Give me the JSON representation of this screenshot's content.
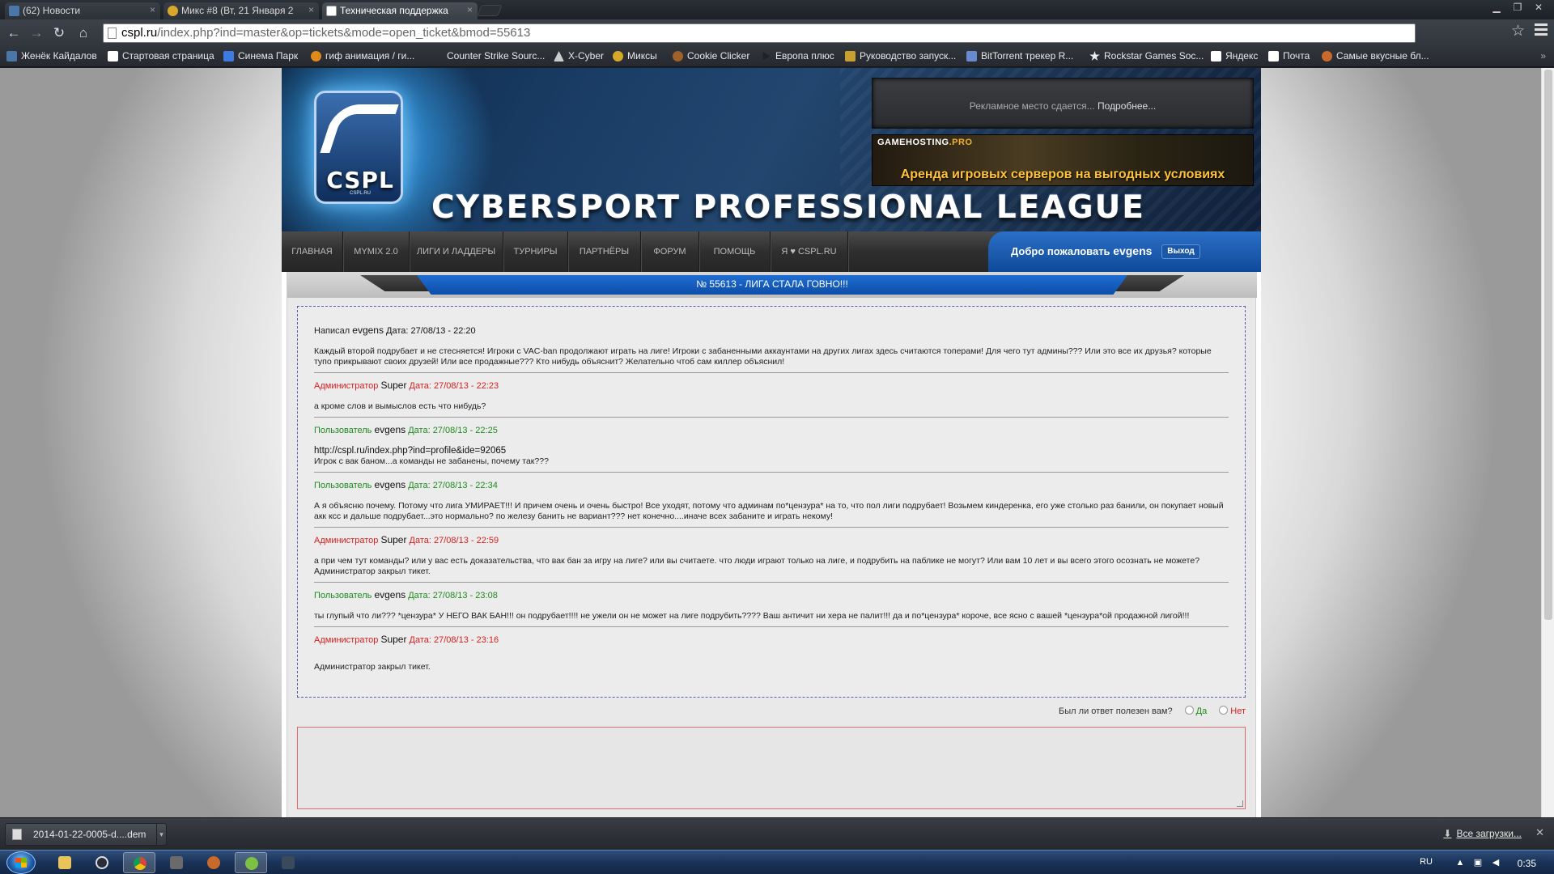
{
  "browser": {
    "tabs": [
      {
        "title": "(62) Новости",
        "favicon": "vk-icon",
        "active": false
      },
      {
        "title": "Микс #8 (Вт, 21 Января 2",
        "favicon": "mix-icon",
        "active": false
      },
      {
        "title": "Техническая поддержка",
        "favicon": "page-icon",
        "active": true
      }
    ],
    "url_host": "cspl.ru",
    "url_path": "/index.php?ind=master&op=tickets&mode=open_ticket&bmod=55613",
    "bookmarks": [
      {
        "label": "Женёк Кайдалов",
        "icon": "vk-icon",
        "color": "#4a76a8"
      },
      {
        "label": "Стартовая страница",
        "icon": "page-icon",
        "color": "#ffffff"
      },
      {
        "label": "Синема Парк",
        "icon": "cinema-icon",
        "color": "#3d7be0"
      },
      {
        "label": "гиф анимация / ги...",
        "icon": "gif-icon",
        "color": "#e08a1c"
      },
      {
        "label": "Counter Strike Sourc...",
        "icon": "",
        "color": ""
      },
      {
        "label": "X-Cyber",
        "icon": "xcyber-icon",
        "color": "#cccccc"
      },
      {
        "label": "Миксы",
        "icon": "mix-icon",
        "color": "#d8a82a"
      },
      {
        "label": "Cookie Clicker",
        "icon": "cookie-icon",
        "color": "#a0622a"
      },
      {
        "label": "Европа плюс",
        "icon": "play-icon",
        "color": "#222222"
      },
      {
        "label": "Руководство запуск...",
        "icon": "guide-icon",
        "color": "#c8a030"
      },
      {
        "label": "BitTorrent трекер R...",
        "icon": "torrent-icon",
        "color": "#6a8ad0"
      },
      {
        "label": "Rockstar Games Soc...",
        "icon": "rockstar-icon",
        "color": "#eeeeee"
      },
      {
        "label": "Яндекс",
        "icon": "page-icon",
        "color": "#ffffff"
      },
      {
        "label": "Почта",
        "icon": "page-icon",
        "color": "#ffffff"
      },
      {
        "label": "Самые вкусные бл...",
        "icon": "food-icon",
        "color": "#c86a2a"
      }
    ]
  },
  "site": {
    "logo_text": "CSPL",
    "logo_sub": "CSPL.RU",
    "title": "CYBERSPORT PROFESSIONAL LEAGUE",
    "ad_text": "Рекламное место сдается...",
    "ad_more": "Подробнее...",
    "banner_brand_a": "GAMEHOSTING",
    "banner_brand_b": ".PRO",
    "banner_text": "Аренда игровых серверов на выгодных условиях",
    "nav": [
      "ГЛАВНАЯ",
      "MYMIX 2.0",
      "ЛИГИ И ЛАДДЕРЫ",
      "ТУРНИРЫ",
      "ПАРТНЁРЫ",
      "ФОРУМ",
      "ПОМОЩЬ",
      "Я ♥ CSPL.RU"
    ],
    "welcome_prefix": "Добро пожаловать",
    "username": "evgens",
    "logout": "Выход"
  },
  "ticket": {
    "title": "№ 55613 - ЛИГА СТАЛА ГОВНО!!!",
    "first_post": {
      "prefix": "Написал",
      "author": "evgens",
      "date": "Дата: 27/08/13 - 22:20",
      "body": "Каждый второй подрубает и не стесняется! Игроки с VAC-ban продолжают играть на лиге! Игроки с забаненными аккаунтами на других лигах здесь считаются топерами! Для чего тут админы??? Или это все их друзья? которые тупо прикрывают своих друзей! Или все продажные??? Кто нибудь объяснит? Желательно чтоб сам киллер объяснил!"
    },
    "replies": [
      {
        "role": "Администратор",
        "author": "Super",
        "date": "Дата: 27/08/13 - 22:23",
        "type": "admin",
        "link": "",
        "body": "а кроме слов и вымыслов есть что нибудь?",
        "extra": ""
      },
      {
        "role": "Пользователь",
        "author": "evgens",
        "date": "Дата: 27/08/13 - 22:25",
        "type": "user",
        "link": "http://cspl.ru/index.php?ind=profile&ide=92065",
        "body": "Игрок с вак баном...а команды не забанены, почему так???",
        "extra": ""
      },
      {
        "role": "Пользователь",
        "author": "evgens",
        "date": "Дата: 27/08/13 - 22:34",
        "type": "user",
        "link": "",
        "body": "А я объясню почему. Потому что лига УМИРАЕТ!!! И причем очень и очень быстро! Все уходят, потому что админам по*цензура* на то, что пол лиги подрубает! Возьмем киндеренка, его уже столько раз банили, он покупает новый акк ксс и дальше подрубает...это нормально? по железу банить не вариант??? нет конечно....иначе всех забаните и играть некому!",
        "extra": ""
      },
      {
        "role": "Администратор",
        "author": "Super",
        "date": "Дата: 27/08/13 - 22:59",
        "type": "admin",
        "link": "",
        "body": "а при чем тут команды? или у вас есть доказательства, что вак бан за игру на лиге? или вы считаете. что люди играют только на лиге, и подрубить на паблике не могут? Или вам 10 лет и вы всего этого осознать не можете?",
        "extra": "Администратор закрыл тикет."
      },
      {
        "role": "Пользователь",
        "author": "evgens",
        "date": "Дата: 27/08/13 - 23:08",
        "type": "user",
        "link": "",
        "body": "ты глупый что ли??? *цензура* У НЕГО ВАК БАН!!! он подрубает!!!! не ужели он не может на лиге подрубить???? Ваш античит ни хера не палит!!! да и по*цензура* короче, все ясно с вашей *цензура*ой продажной лигой!!!",
        "extra": ""
      },
      {
        "role": "Администратор",
        "author": "Super",
        "date": "Дата: 27/08/13 - 23:16",
        "type": "admin",
        "link": "",
        "body": "",
        "extra": ""
      }
    ],
    "closed_note": "Администратор закрыл тикет.",
    "helpful_q": "Был ли ответ полезен вам?",
    "helpful_yes": "Да",
    "helpful_no": "Нет"
  },
  "downloads": {
    "file": "2014-01-22-0005-d....dem",
    "all": "Все загрузки..."
  },
  "taskbar": {
    "lang": "RU",
    "clock": "0:35"
  }
}
